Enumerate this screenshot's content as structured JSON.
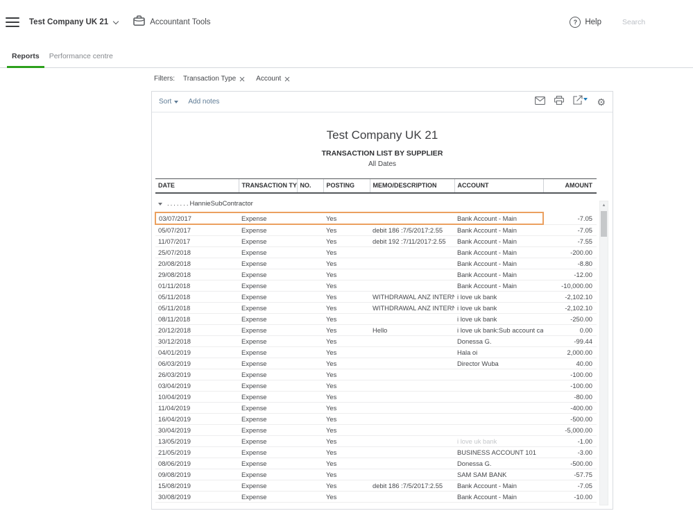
{
  "navbar": {
    "company_name": "Test Company UK 21",
    "accountant_tools_label": "Accountant Tools",
    "help_label": "Help",
    "search_placeholder": "Search"
  },
  "tabs": [
    {
      "label": "Reports",
      "active": true
    },
    {
      "label": "Performance centre",
      "active": false
    }
  ],
  "filters": {
    "label": "Filters:",
    "chips": [
      "Transaction Type",
      "Account"
    ]
  },
  "toolbar": {
    "sort_label": "Sort",
    "add_notes_label": "Add notes",
    "icons": [
      "envelope-icon",
      "printer-icon",
      "export-icon",
      "gear-icon"
    ]
  },
  "report": {
    "company": "Test Company UK 21",
    "title": "TRANSACTION LIST BY SUPPLIER",
    "date_range": "All Dates",
    "columns": [
      "DATE",
      "TRANSACTION TYPE",
      "NO.",
      "POSTING",
      "MEMO/DESCRIPTION",
      "ACCOUNT",
      "AMOUNT"
    ],
    "group": {
      "prefix": ".......",
      "name": "HannieSubContractor"
    },
    "rows": [
      {
        "date": "03/07/2017",
        "type": "Expense",
        "no": "",
        "posting": "Yes",
        "memo": "",
        "account": "Bank Account - Main",
        "amount": "-7.05",
        "highlighted": true
      },
      {
        "date": "05/07/2017",
        "type": "Expense",
        "no": "",
        "posting": "Yes",
        "memo": "debit 186 :7/5/2017:2.55",
        "account": "Bank Account - Main",
        "amount": "-7.05"
      },
      {
        "date": "11/07/2017",
        "type": "Expense",
        "no": "",
        "posting": "Yes",
        "memo": "debit 192 :7/11/2017:2.55",
        "account": "Bank Account - Main",
        "amount": "-7.55"
      },
      {
        "date": "25/07/2018",
        "type": "Expense",
        "no": "",
        "posting": "Yes",
        "memo": "",
        "account": "Bank Account - Main",
        "amount": "-200.00"
      },
      {
        "date": "20/08/2018",
        "type": "Expense",
        "no": "",
        "posting": "Yes",
        "memo": "",
        "account": "Bank Account - Main",
        "amount": "-8.80"
      },
      {
        "date": "29/08/2018",
        "type": "Expense",
        "no": "",
        "posting": "Yes",
        "memo": "",
        "account": "Bank Account - Main",
        "amount": "-12.00"
      },
      {
        "date": "01/11/2018",
        "type": "Expense",
        "no": "",
        "posting": "Yes",
        "memo": "",
        "account": "Bank Account - Main",
        "amount": "-10,000.00"
      },
      {
        "date": "05/11/2018",
        "type": "Expense",
        "no": "",
        "posting": "Yes",
        "memo": "WITHDRAWAL ANZ INTERNET B...",
        "account": "i love uk bank",
        "amount": "-2,102.10"
      },
      {
        "date": "05/11/2018",
        "type": "Expense",
        "no": "",
        "posting": "Yes",
        "memo": "WITHDRAWAL ANZ INTERNET B...",
        "account": "i love uk bank",
        "amount": "-2,102.10"
      },
      {
        "date": "08/11/2018",
        "type": "Expense",
        "no": "",
        "posting": "Yes",
        "memo": "",
        "account": "i love uk bank",
        "amount": "-250.00"
      },
      {
        "date": "20/12/2018",
        "type": "Expense",
        "no": "",
        "posting": "Yes",
        "memo": "Hello",
        "account": "i love uk bank:Sub account cash ...",
        "amount": "0.00"
      },
      {
        "date": "30/12/2018",
        "type": "Expense",
        "no": "",
        "posting": "Yes",
        "memo": "",
        "account": "Donessa G.",
        "amount": "-99.44"
      },
      {
        "date": "04/01/2019",
        "type": "Expense",
        "no": "",
        "posting": "Yes",
        "memo": "",
        "account": "Hala oi",
        "amount": "2,000.00"
      },
      {
        "date": "06/03/2019",
        "type": "Expense",
        "no": "",
        "posting": "Yes",
        "memo": "",
        "account": "Director Wuba",
        "amount": "40.00"
      },
      {
        "date": "26/03/2019",
        "type": "Expense",
        "no": "",
        "posting": "Yes",
        "memo": "",
        "account": "",
        "amount": "-100.00"
      },
      {
        "date": "03/04/2019",
        "type": "Expense",
        "no": "",
        "posting": "Yes",
        "memo": "",
        "account": "",
        "amount": "-100.00"
      },
      {
        "date": "10/04/2019",
        "type": "Expense",
        "no": "",
        "posting": "Yes",
        "memo": "",
        "account": "",
        "amount": "-80.00"
      },
      {
        "date": "11/04/2019",
        "type": "Expense",
        "no": "",
        "posting": "Yes",
        "memo": "",
        "account": "",
        "amount": "-400.00"
      },
      {
        "date": "16/04/2019",
        "type": "Expense",
        "no": "",
        "posting": "Yes",
        "memo": "",
        "account": "",
        "amount": "-500.00"
      },
      {
        "date": "30/04/2019",
        "type": "Expense",
        "no": "",
        "posting": "Yes",
        "memo": "",
        "account": "",
        "amount": "-5,000.00"
      },
      {
        "date": "13/05/2019",
        "type": "Expense",
        "no": "",
        "posting": "Yes",
        "memo": "",
        "account": "i love uk bank",
        "account_faded": true,
        "amount": "-1.00"
      },
      {
        "date": "21/05/2019",
        "type": "Expense",
        "no": "",
        "posting": "Yes",
        "memo": "",
        "account": "BUSINESS ACCOUNT 101",
        "amount": "-3.00"
      },
      {
        "date": "08/06/2019",
        "type": "Expense",
        "no": "",
        "posting": "Yes",
        "memo": "",
        "account": "Donessa G.",
        "amount": "-500.00"
      },
      {
        "date": "09/08/2019",
        "type": "Expense",
        "no": "",
        "posting": "Yes",
        "memo": "",
        "account": "SAM SAM BANK",
        "amount": "-57.75"
      },
      {
        "date": "15/08/2019",
        "type": "Expense",
        "no": "",
        "posting": "Yes",
        "memo": "debit 186 :7/5/2017:2.55",
        "account": "Bank Account - Main",
        "amount": "-7.05"
      },
      {
        "date": "30/08/2019",
        "type": "Expense",
        "no": "",
        "posting": "Yes",
        "memo": "",
        "account": "Bank Account - Main",
        "amount": "-10.00"
      }
    ]
  },
  "colors": {
    "accent_green": "#2ca01c",
    "highlight_orange": "#eba05f",
    "link_blue": "#5d7a94",
    "text_dark": "#393a3d"
  }
}
